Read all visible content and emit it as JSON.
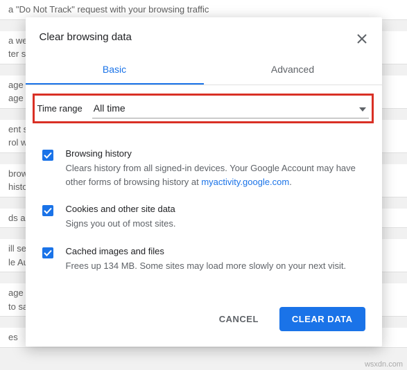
{
  "background": {
    "row1": "a \"Do Not Track\" request with your browsing traffic",
    "row2a": "a web s",
    "row2b": "ter sp",
    "row3a": "age ce",
    "row3b": "age HT",
    "row4a": "ent set",
    "row4b": "rol wh",
    "row5a": "browsi",
    "row5b": "histor",
    "row6": "ds and",
    "row7a": "ill sett",
    "row7b": "le Aut",
    "row8a": "age pa",
    "row8b": "to sav",
    "row9": "es"
  },
  "dialog": {
    "title": "Clear browsing data",
    "tabs": {
      "basic": "Basic",
      "advanced": "Advanced"
    },
    "time_range": {
      "label": "Time range",
      "value": "All time"
    },
    "options": {
      "history": {
        "title": "Browsing history",
        "desc_pre": "Clears history from all signed-in devices. Your Google Account may have other forms of browsing history at ",
        "link": "myactivity.google.com",
        "desc_post": "."
      },
      "cookies": {
        "title": "Cookies and other site data",
        "desc": "Signs you out of most sites."
      },
      "cache": {
        "title": "Cached images and files",
        "desc": "Frees up 134 MB. Some sites may load more slowly on your next visit."
      }
    },
    "buttons": {
      "cancel": "CANCEL",
      "clear": "CLEAR DATA"
    }
  },
  "watermark": "wsxdn.com"
}
